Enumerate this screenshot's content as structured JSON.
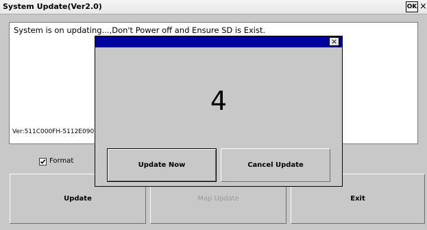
{
  "window": {
    "title": "System Update(Ver2.0)",
    "ok_label": "OK",
    "close_label": "×"
  },
  "log": {
    "message": "System is on  updating...,Don't Power off and Ensure SD is Exist.",
    "version": "Ver:511C000FH-5112E0907"
  },
  "format": {
    "label": "Format",
    "checked": true
  },
  "buttons": {
    "update": "Update",
    "map_update": "Map Update",
    "exit": "Exit"
  },
  "dialog": {
    "close_label": "×",
    "countdown": "4",
    "update_now": "Update Now",
    "cancel_update": "Cancel Update"
  },
  "colors": {
    "window_bg": "#c8c8c8",
    "dialog_title_bar": "#00009c"
  }
}
